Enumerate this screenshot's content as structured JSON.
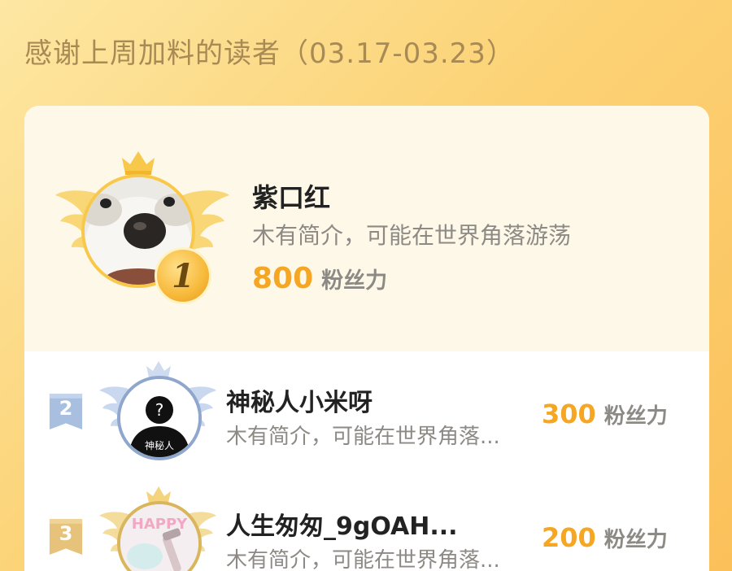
{
  "header": {
    "title": "感谢上周加料的读者（03.17-03.23）"
  },
  "colors": {
    "accent": "#f5a623",
    "background_top": "#fde7a3",
    "background_bottom": "#fbc05a",
    "card": "#ffffff",
    "top_section": "#fdf8e8"
  },
  "ranking": [
    {
      "rank": "1",
      "name": "紫口红",
      "bio": "木有简介，可能在世界角落游荡",
      "score": "800",
      "unit": "粉丝力",
      "avatar_icon": "dog-avatar"
    },
    {
      "rank": "2",
      "name": "神秘人小米呀",
      "bio": "木有简介，可能在世界角落...",
      "score": "300",
      "unit": "粉丝力",
      "avatar_icon": "mystery-person-avatar",
      "avatar_caption": "神秘人",
      "avatar_mark": "?"
    },
    {
      "rank": "3",
      "name": "人生匆匆_9gOAH...",
      "bio": "木有简介，可能在世界角落...",
      "score": "200",
      "unit": "粉丝力",
      "avatar_icon": "happy-avatar",
      "avatar_caption": "HAPPY"
    }
  ]
}
